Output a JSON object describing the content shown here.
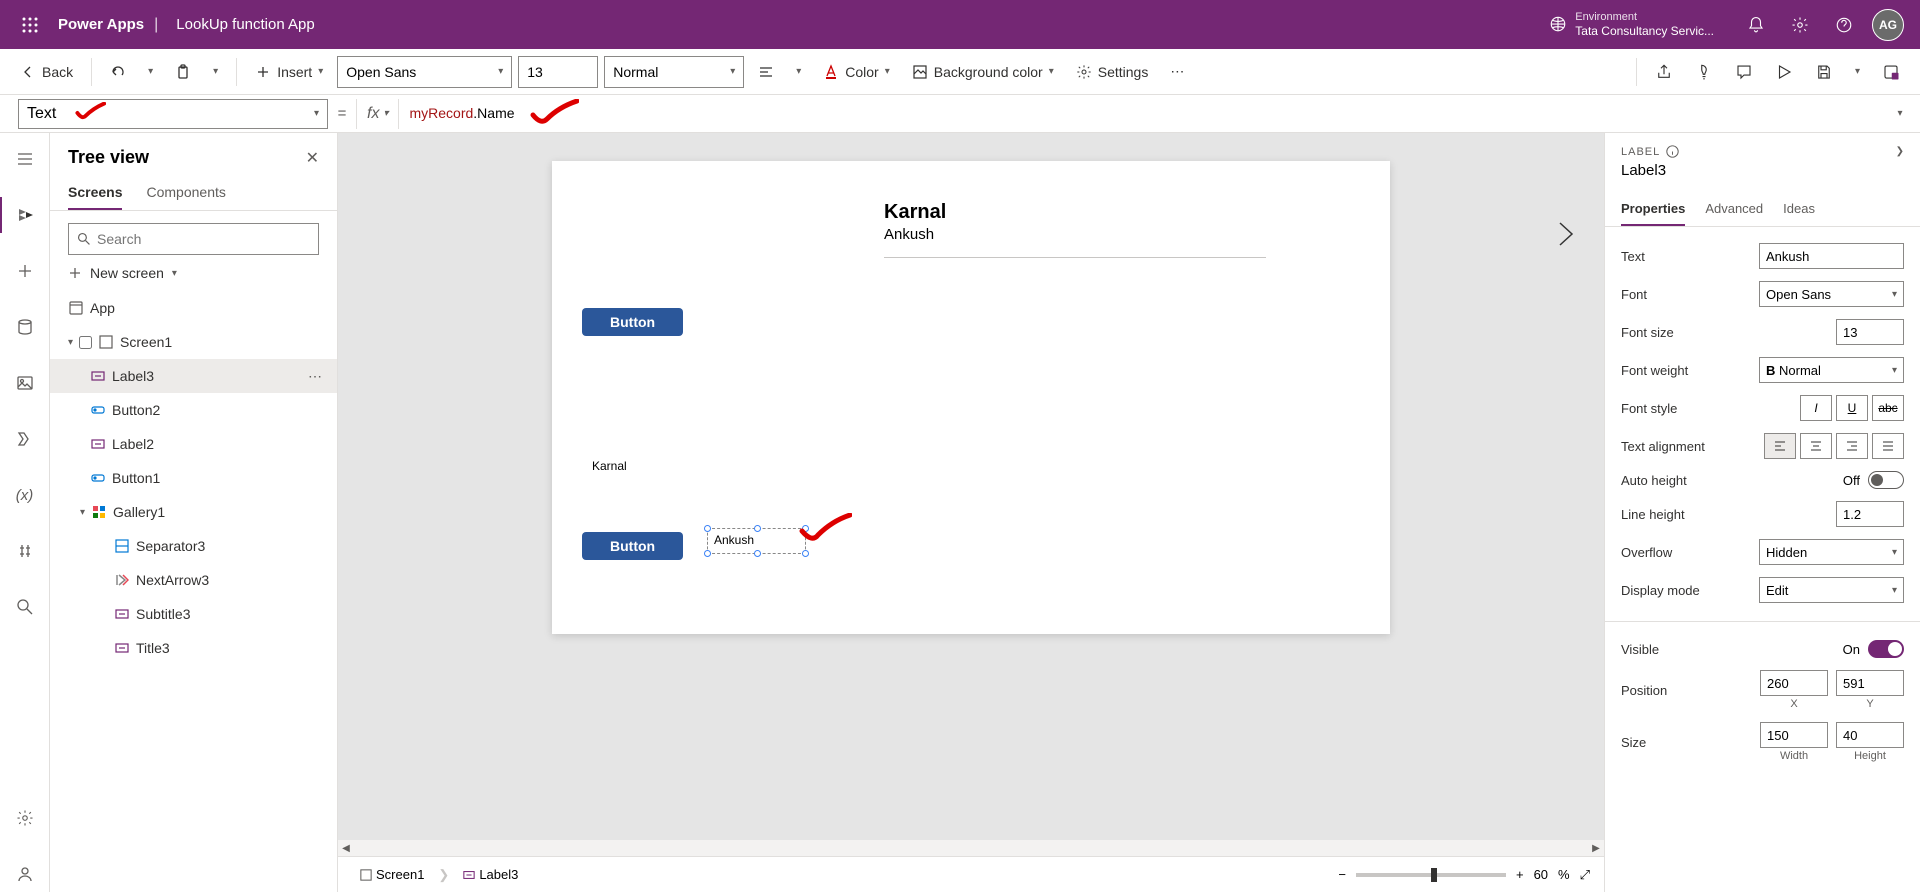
{
  "header": {
    "app_name": "Power Apps",
    "separator": "|",
    "file_name": "LookUp function App",
    "env_label": "Environment",
    "env_name": "Tata Consultancy Servic...",
    "avatar_initials": "AG"
  },
  "ribbon": {
    "back": "Back",
    "insert": "Insert",
    "font": "Open Sans",
    "font_size": "13",
    "font_weight": "Normal",
    "color": "Color",
    "bg_color": "Background color",
    "settings": "Settings"
  },
  "formula": {
    "property": "Text",
    "equals": "=",
    "fx_label": "fx",
    "expr_var": "myRecord",
    "expr_rest": ".Name"
  },
  "tree": {
    "title": "Tree view",
    "tab_screens": "Screens",
    "tab_components": "Components",
    "search_placeholder": "Search",
    "new_screen": "New screen",
    "items": {
      "app": "App",
      "screen1": "Screen1",
      "label3": "Label3",
      "button2": "Button2",
      "label2": "Label2",
      "button1": "Button1",
      "gallery1": "Gallery1",
      "separator3": "Separator3",
      "nextarrow3": "NextArrow3",
      "subtitle3": "Subtitle3",
      "title3": "Title3"
    }
  },
  "canvas": {
    "title": "Karnal",
    "subtitle": "Ankush",
    "button_label": "Button",
    "label_karnal": "Karnal",
    "label_ankush": "Ankush"
  },
  "footer": {
    "crumb1": "Screen1",
    "crumb2": "Label3",
    "zoom": "60",
    "pct": "%"
  },
  "right": {
    "type": "LABEL",
    "name": "Label3",
    "tab_properties": "Properties",
    "tab_advanced": "Advanced",
    "tab_ideas": "Ideas",
    "props": {
      "text_label": "Text",
      "text_value": "Ankush",
      "font_label": "Font",
      "font_value": "Open Sans",
      "fontsize_label": "Font size",
      "fontsize_value": "13",
      "fontweight_label": "Font weight",
      "fontweight_value": "Normal",
      "fontweight_b": "B",
      "fontstyle_label": "Font style",
      "textalign_label": "Text alignment",
      "autoheight_label": "Auto height",
      "autoheight_value": "Off",
      "lineheight_label": "Line height",
      "lineheight_value": "1.2",
      "overflow_label": "Overflow",
      "overflow_value": "Hidden",
      "displaymode_label": "Display mode",
      "displaymode_value": "Edit",
      "visible_label": "Visible",
      "visible_value": "On",
      "position_label": "Position",
      "pos_x": "260",
      "pos_y": "591",
      "x_label": "X",
      "y_label": "Y",
      "size_label": "Size",
      "width": "150",
      "height": "40",
      "width_label": "Width",
      "height_label": "Height"
    }
  }
}
